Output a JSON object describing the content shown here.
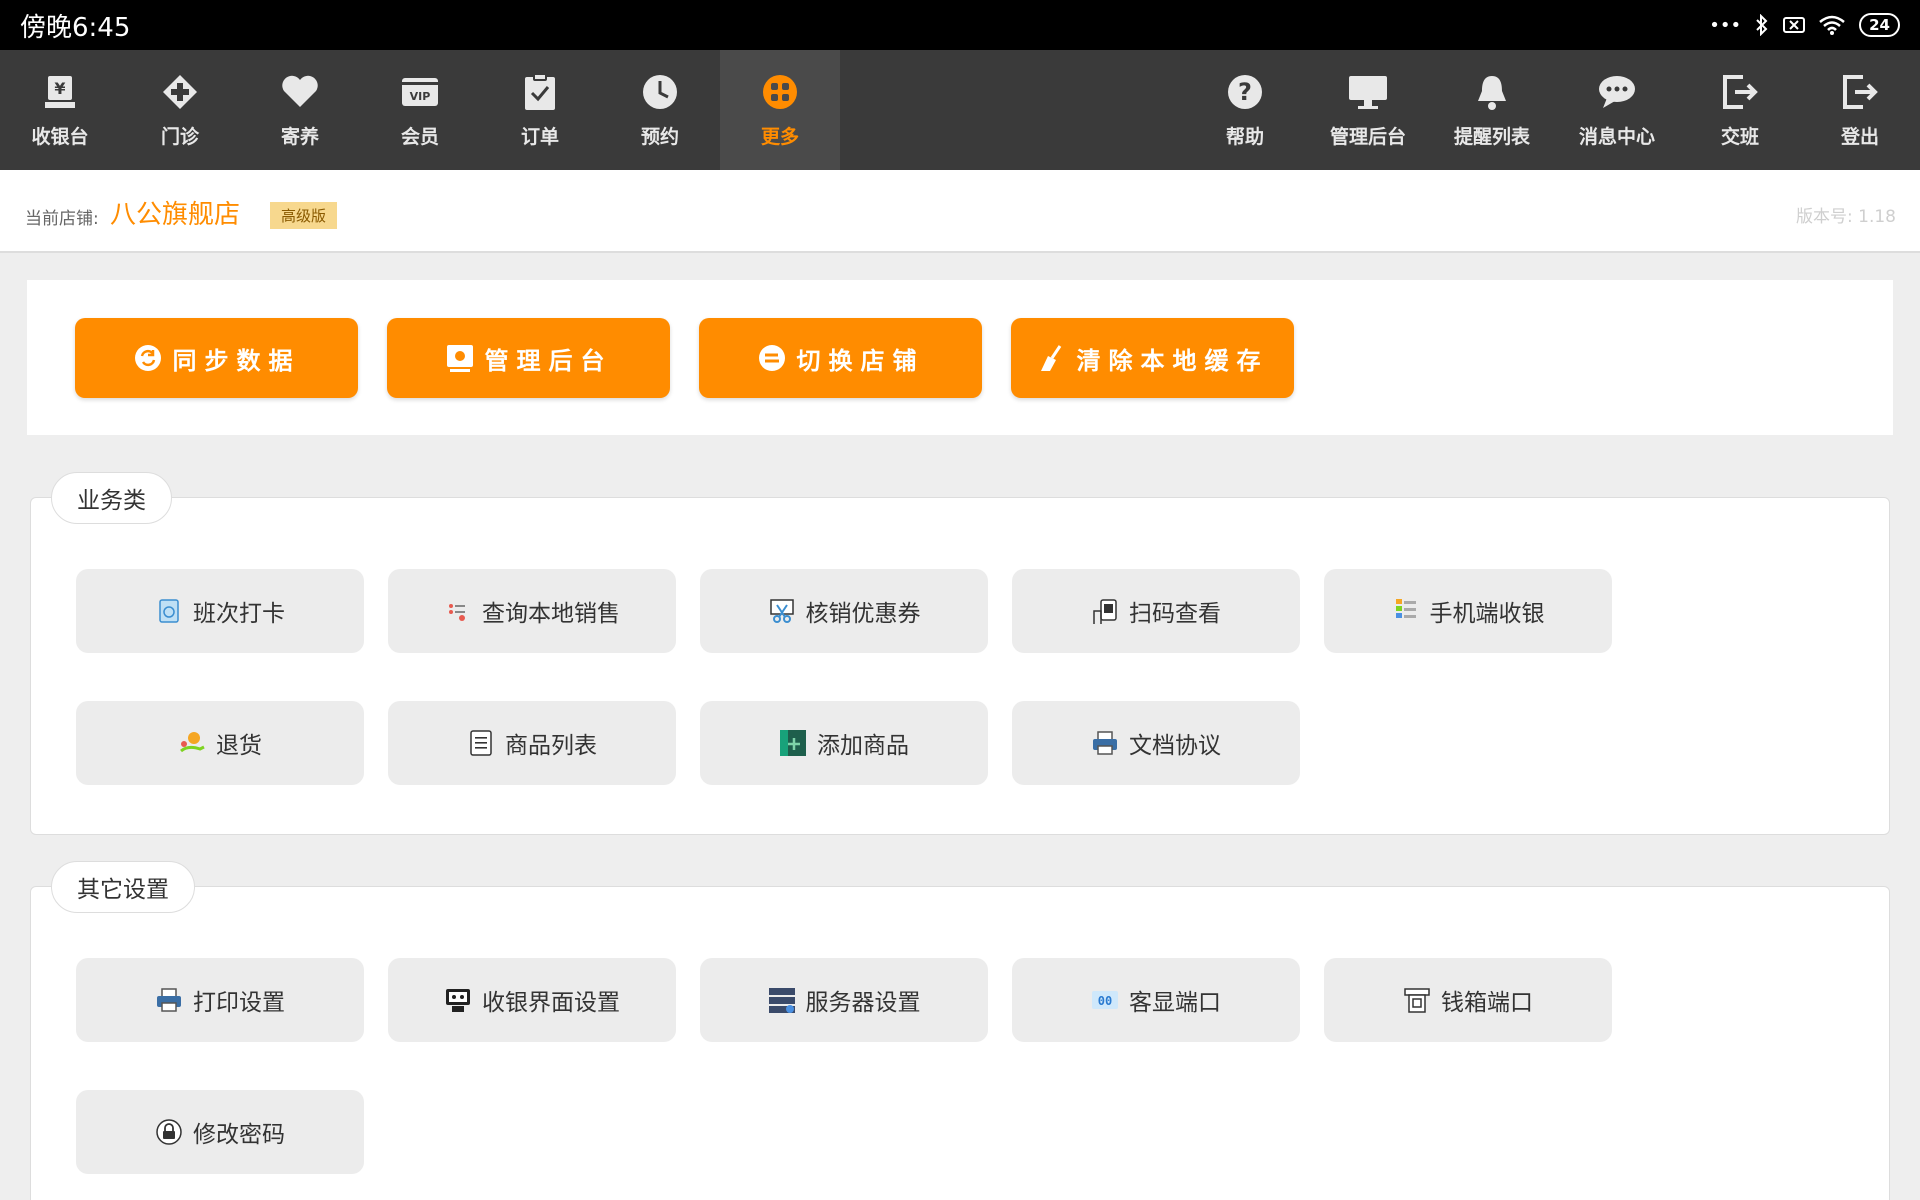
{
  "status_bar": {
    "time": "傍晚6:45",
    "dots": "•••",
    "battery": "24"
  },
  "nav": {
    "left": [
      {
        "label": "收银台",
        "icon": "cash-register-icon"
      },
      {
        "label": "门诊",
        "icon": "medical-cross-icon"
      },
      {
        "label": "寄养",
        "icon": "heart-icon"
      },
      {
        "label": "会员",
        "icon": "vip-card-icon"
      },
      {
        "label": "订单",
        "icon": "clipboard-check-icon"
      },
      {
        "label": "预约",
        "icon": "clock-icon"
      },
      {
        "label": "更多",
        "icon": "more-grid-icon",
        "active": true
      }
    ],
    "right": [
      {
        "label": "帮助",
        "icon": "help-icon"
      },
      {
        "label": "管理后台",
        "icon": "monitor-icon"
      },
      {
        "label": "提醒列表",
        "icon": "bell-icon"
      },
      {
        "label": "消息中心",
        "icon": "chat-icon"
      },
      {
        "label": "交班",
        "icon": "handover-exit-icon"
      },
      {
        "label": "登出",
        "icon": "logout-icon"
      }
    ]
  },
  "store": {
    "prefix": "当前店铺:",
    "name": "八公旗舰店",
    "badge": "高级版",
    "version": "版本号: 1.18"
  },
  "actions": [
    {
      "label": "同步数据",
      "icon": "sync-icon"
    },
    {
      "label": "管理后台",
      "icon": "admin-board-icon"
    },
    {
      "label": "切换店铺",
      "icon": "switch-store-icon"
    },
    {
      "label": "清除本地缓存",
      "icon": "broom-icon"
    }
  ],
  "sections": [
    {
      "title": "业务类",
      "tiles": [
        {
          "label": "班次打卡",
          "icon": "shift-clock-icon"
        },
        {
          "label": "查询本地销售",
          "icon": "sales-list-icon"
        },
        {
          "label": "核销优惠券",
          "icon": "coupon-cut-icon"
        },
        {
          "label": "扫码查看",
          "icon": "scan-icon"
        },
        {
          "label": "手机端收银",
          "icon": "mobile-cashier-icon"
        },
        {
          "label": "退货",
          "icon": "return-goods-icon"
        },
        {
          "label": "商品列表",
          "icon": "product-list-icon"
        },
        {
          "label": "添加商品",
          "icon": "add-product-icon"
        },
        {
          "label": "文档协议",
          "icon": "document-printer-icon"
        }
      ]
    },
    {
      "title": "其它设置",
      "tiles": [
        {
          "label": "打印设置",
          "icon": "printer-icon"
        },
        {
          "label": "收银界面设置",
          "icon": "cashier-ui-icon"
        },
        {
          "label": "服务器设置",
          "icon": "server-icon"
        },
        {
          "label": "客显端口",
          "icon": "customer-display-icon"
        },
        {
          "label": "钱箱端口",
          "icon": "cash-drawer-icon"
        },
        {
          "label": "修改密码",
          "icon": "lock-password-icon"
        }
      ]
    }
  ]
}
